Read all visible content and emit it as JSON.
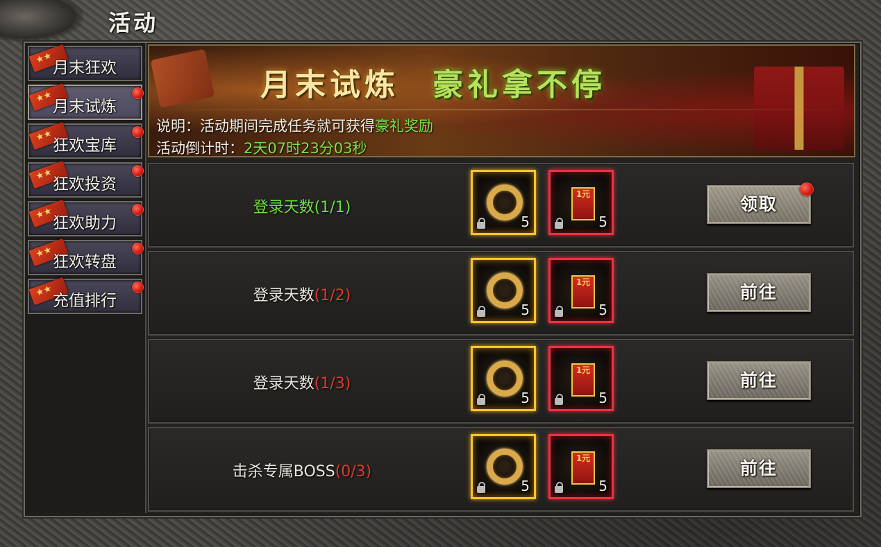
{
  "window": {
    "title": "活动"
  },
  "sidebar": {
    "items": [
      {
        "label": "月末狂欢",
        "badge": false,
        "active": false
      },
      {
        "label": "月末试炼",
        "badge": true,
        "active": true
      },
      {
        "label": "狂欢宝库",
        "badge": true,
        "active": false
      },
      {
        "label": "狂欢投资",
        "badge": true,
        "active": false
      },
      {
        "label": "狂欢助力",
        "badge": true,
        "active": false
      },
      {
        "label": "狂欢转盘",
        "badge": true,
        "active": false
      },
      {
        "label": "充值排行",
        "badge": true,
        "active": false
      }
    ]
  },
  "banner": {
    "title_part1": "月末试炼",
    "title_part2": "豪礼拿不停",
    "desc_prefix": "说明：活动期间完成任务就可获得",
    "desc_highlight": "豪礼奖励",
    "countdown_label": "活动倒计时：",
    "countdown_value": "2天07时23分03秒"
  },
  "tasks": [
    {
      "name": "登录天数",
      "progress": "(1/1)",
      "done": true,
      "button": "领取",
      "button_badge": true,
      "rewards": [
        {
          "type": "ring",
          "qty": "5",
          "icon": "gold-ring-icon"
        },
        {
          "type": "envelope",
          "qty": "5",
          "icon": "red-envelope-icon",
          "text": "1元"
        }
      ]
    },
    {
      "name": "登录天数",
      "progress": "(1/2)",
      "done": false,
      "button": "前往",
      "button_badge": false,
      "rewards": [
        {
          "type": "ring",
          "qty": "5",
          "icon": "gold-ring-icon"
        },
        {
          "type": "envelope",
          "qty": "5",
          "icon": "red-envelope-icon",
          "text": "1元"
        }
      ]
    },
    {
      "name": "登录天数",
      "progress": "(1/3)",
      "done": false,
      "button": "前往",
      "button_badge": false,
      "rewards": [
        {
          "type": "ring",
          "qty": "5",
          "icon": "gold-ring-icon"
        },
        {
          "type": "envelope",
          "qty": "5",
          "icon": "red-envelope-icon",
          "text": "1元"
        }
      ]
    },
    {
      "name": "击杀专属BOSS",
      "progress": "(0/3)",
      "done": false,
      "button": "前往",
      "button_badge": false,
      "rewards": [
        {
          "type": "ring",
          "qty": "5",
          "icon": "gold-ring-icon"
        },
        {
          "type": "envelope",
          "qty": "5",
          "icon": "red-envelope-icon",
          "text": "1元"
        }
      ]
    }
  ],
  "colors": {
    "done_text": "#6ee03f",
    "progress_incomplete": "#e03b2d",
    "highlight_green": "#7be04a"
  }
}
